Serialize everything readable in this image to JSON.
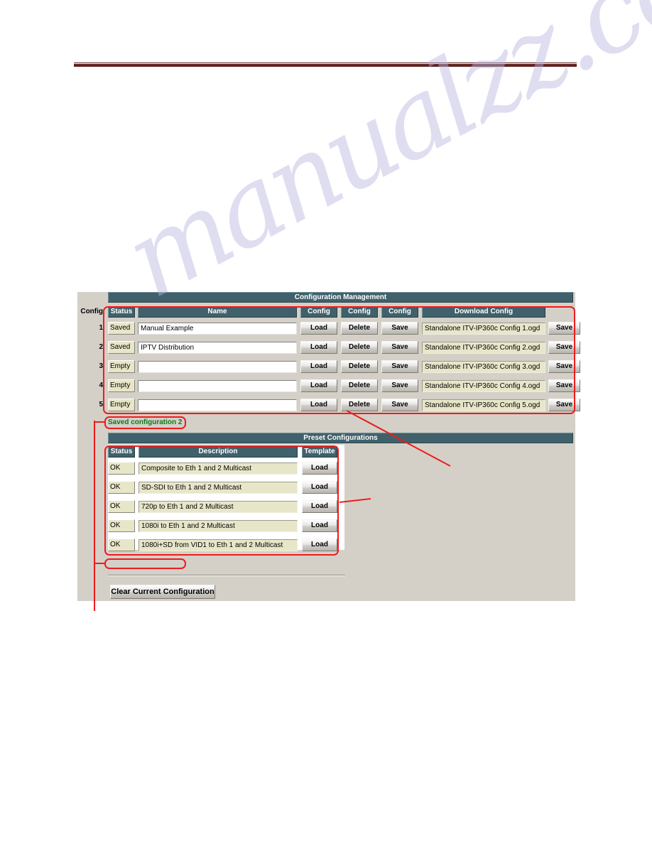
{
  "page": {
    "watermark": "manualzz.com"
  },
  "config_management": {
    "title": "Configuration Management",
    "row_axis_label": "Config",
    "columns": [
      "Status",
      "Name",
      "Config",
      "Config",
      "Config",
      "Download Config"
    ],
    "headers": {
      "status": "Status",
      "name": "Name",
      "config1": "Config",
      "config2": "Config",
      "config3": "Config",
      "download": "Download Config"
    },
    "rows": [
      {
        "index": "1",
        "status": "Saved",
        "name": "Manual Example",
        "load": "Load",
        "delete": "Delete",
        "save": "Save",
        "file": "Standalone ITV-IP360c Config 1.ogd",
        "download_save": "Save"
      },
      {
        "index": "2",
        "status": "Saved",
        "name": "IPTV Distribution",
        "load": "Load",
        "delete": "Delete",
        "save": "Save",
        "file": "Standalone ITV-IP360c Config 2.ogd",
        "download_save": "Save"
      },
      {
        "index": "3",
        "status": "Empty",
        "name": "",
        "load": "Load",
        "delete": "Delete",
        "save": "Save",
        "file": "Standalone ITV-IP360c Config 3.ogd",
        "download_save": "Save"
      },
      {
        "index": "4",
        "status": "Empty",
        "name": "",
        "load": "Load",
        "delete": "Delete",
        "save": "Save",
        "file": "Standalone ITV-IP360c Config 4.ogd",
        "download_save": "Save"
      },
      {
        "index": "5",
        "status": "Empty",
        "name": "",
        "load": "Load",
        "delete": "Delete",
        "save": "Save",
        "file": "Standalone ITV-IP360c Config 5.ogd",
        "download_save": "Save"
      }
    ],
    "status_message": "Saved configuration 2",
    "status_message_color": "#0c7a18"
  },
  "preset_configurations": {
    "title": "Preset Configurations",
    "headers": {
      "status": "Status",
      "description": "Description",
      "template": "Template"
    },
    "rows": [
      {
        "status": "OK",
        "description": "Composite to Eth 1 and 2 Multicast",
        "load": "Load"
      },
      {
        "status": "OK",
        "description": "SD-SDI to Eth 1 and 2 Multicast",
        "load": "Load"
      },
      {
        "status": "OK",
        "description": "720p to Eth 1 and 2 Multicast",
        "load": "Load"
      },
      {
        "status": "OK",
        "description": "1080i to Eth 1 and 2 Multicast",
        "load": "Load"
      },
      {
        "status": "OK",
        "description": "1080i+SD from VID1 to Eth 1 and 2 Multicast",
        "load": "Load"
      }
    ]
  },
  "footer": {
    "clear_button": "Clear Current Configuration"
  },
  "colors": {
    "header_bar": "#40616b",
    "panel": "#d4d0c8",
    "status_cell": "#e8e6c9",
    "annotation": "#ee1c1c",
    "rule": "#5e2220",
    "status_text": "#0c7a18"
  }
}
